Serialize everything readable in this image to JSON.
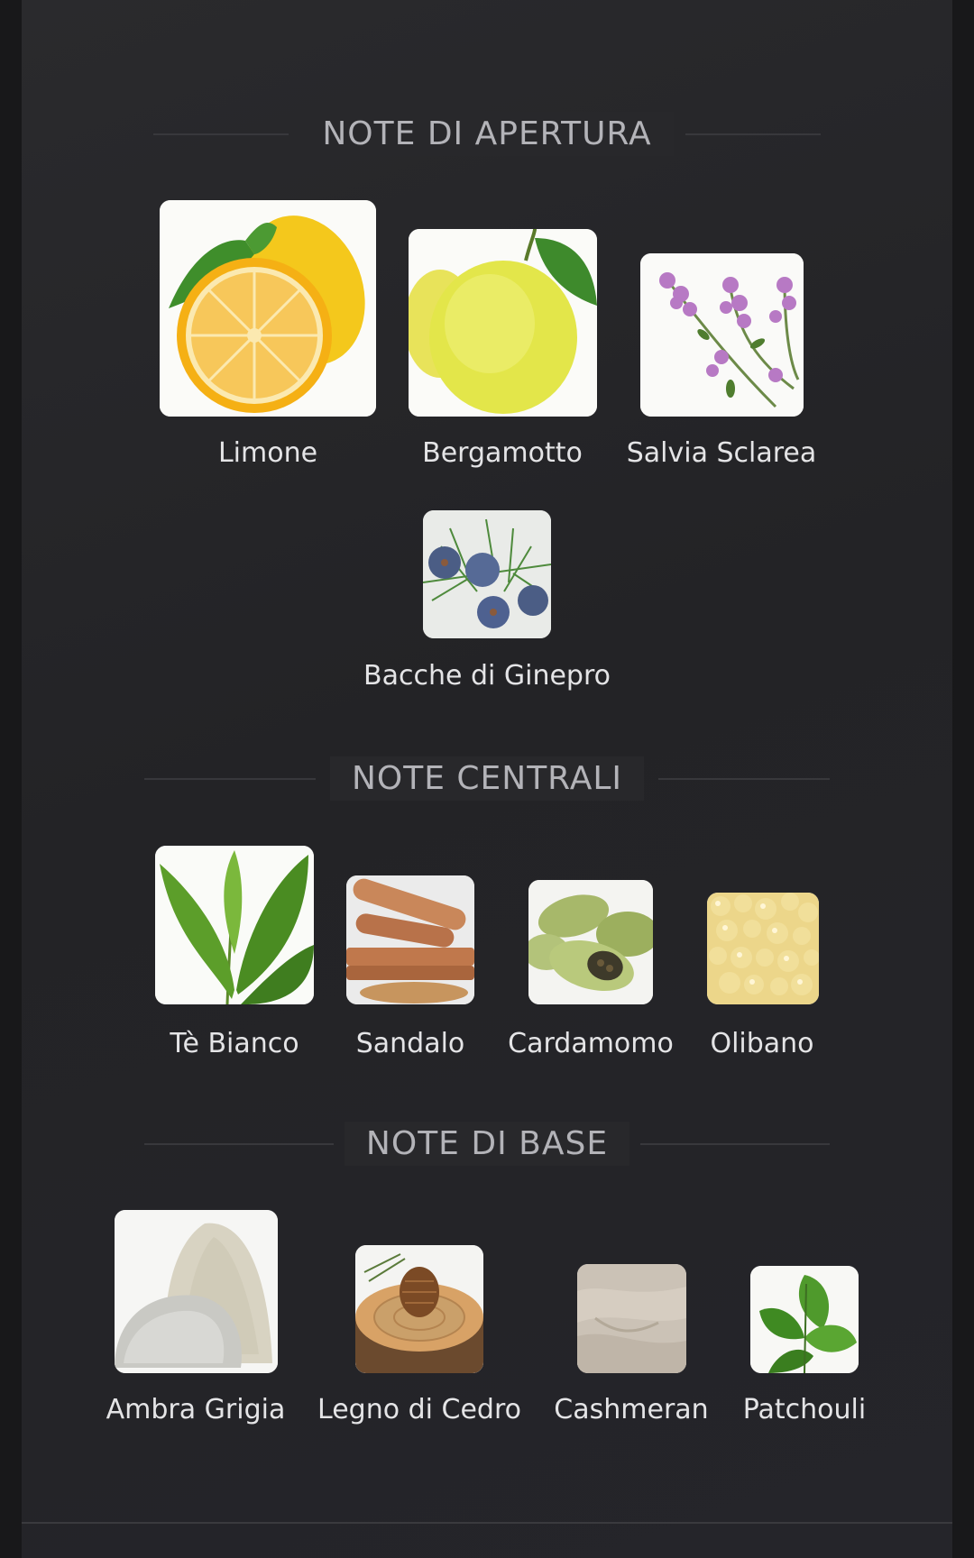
{
  "sections": [
    {
      "title": "NOTE DI APERTURA",
      "notes": [
        {
          "label": "Limone",
          "icon": "lemon-icon"
        },
        {
          "label": "Bergamotto",
          "icon": "bergamot-icon"
        },
        {
          "label": "Salvia Sclarea",
          "icon": "clary-sage-icon"
        },
        {
          "label": "Bacche di Ginepro",
          "icon": "juniper-berries-icon"
        }
      ]
    },
    {
      "title": "NOTE CENTRALI",
      "notes": [
        {
          "label": "Tè Bianco",
          "icon": "white-tea-icon"
        },
        {
          "label": "Sandalo",
          "icon": "sandalwood-icon"
        },
        {
          "label": "Cardamomo",
          "icon": "cardamom-icon"
        },
        {
          "label": "Olibano",
          "icon": "frankincense-icon"
        }
      ]
    },
    {
      "title": "NOTE DI BASE",
      "notes": [
        {
          "label": "Ambra Grigia",
          "icon": "ambergris-icon"
        },
        {
          "label": "Legno di Cedro",
          "icon": "cedarwood-icon"
        },
        {
          "label": "Cashmeran",
          "icon": "cashmeran-icon"
        },
        {
          "label": "Patchouli",
          "icon": "patchouli-icon"
        }
      ]
    }
  ]
}
